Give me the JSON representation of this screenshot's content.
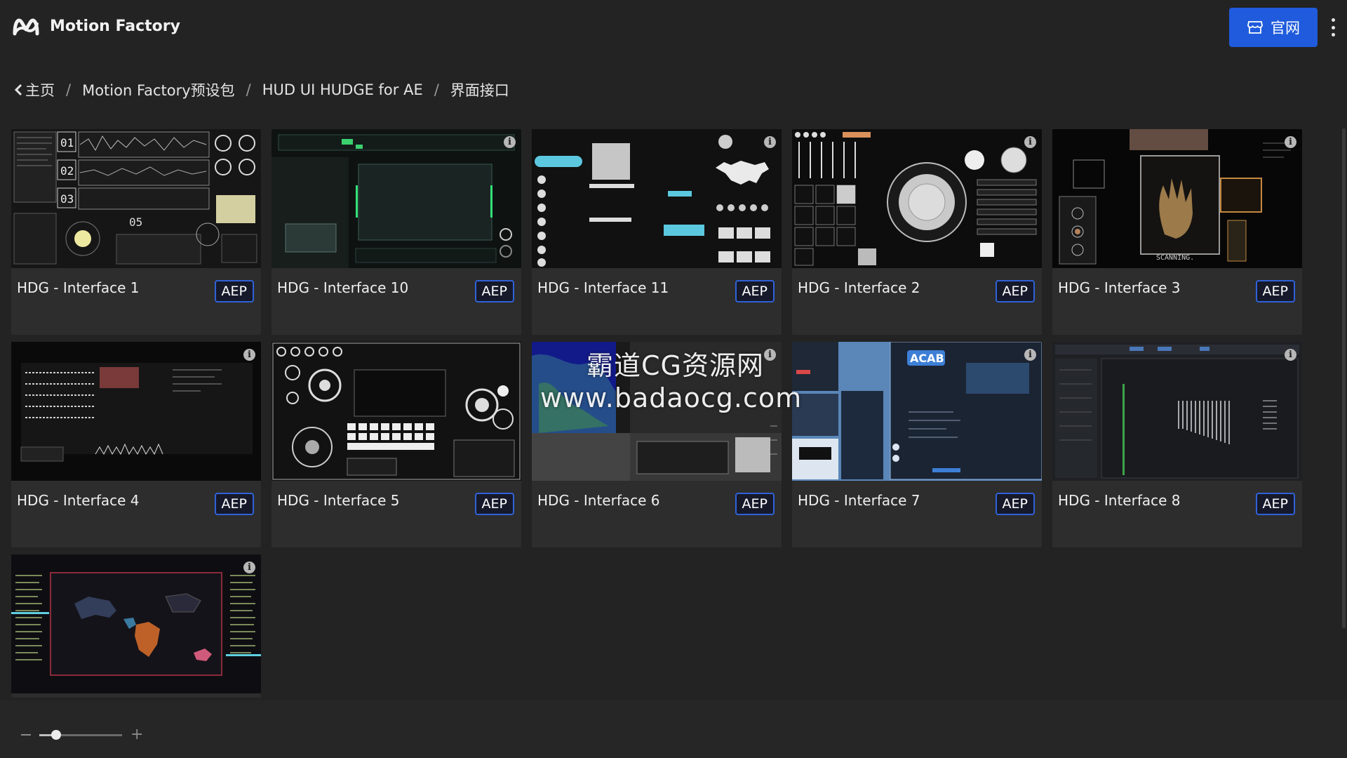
{
  "header": {
    "brand": "Motion Factory",
    "site_button_label": "官网"
  },
  "breadcrumb": {
    "items": [
      "主页",
      "Motion Factory预设包",
      "HUD UI HUDGE for AE",
      "界面接口"
    ],
    "separator": "/"
  },
  "cards": [
    {
      "title": "HDG - Interface 1",
      "badge": "AEP"
    },
    {
      "title": "HDG - Interface 10",
      "badge": "AEP"
    },
    {
      "title": "HDG - Interface 11",
      "badge": "AEP"
    },
    {
      "title": "HDG - Interface 2",
      "badge": "AEP"
    },
    {
      "title": "HDG - Interface 3",
      "badge": "AEP"
    },
    {
      "title": "HDG - Interface 4",
      "badge": "AEP"
    },
    {
      "title": "HDG - Interface 5",
      "badge": "AEP"
    },
    {
      "title": "HDG - Interface 6",
      "badge": "AEP"
    },
    {
      "title": "HDG - Interface 7",
      "badge": "AEP"
    },
    {
      "title": "HDG - Interface 8",
      "badge": "AEP"
    },
    {
      "title": "",
      "badge": ""
    }
  ],
  "thumb_text": {
    "t1_01": "01",
    "t1_02": "02",
    "t1_03": "03",
    "t1_05": "05",
    "t3_scanning": "SCANNING.",
    "t7_acab": "ACAB"
  },
  "info_glyph": "i",
  "watermark": {
    "line1": "霸道CG资源网",
    "line2": "www.badaocg.com"
  },
  "zoom": {
    "level": 0.2
  },
  "colors": {
    "background": "#232323",
    "card": "#2d2d2d",
    "accent": "#1f5bdc",
    "badge_border": "#2f62d8"
  }
}
